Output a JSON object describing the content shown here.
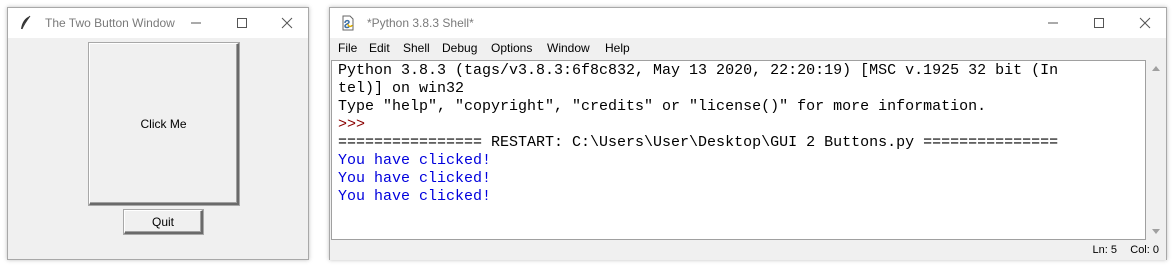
{
  "tk_window": {
    "title": "The Two Button Window",
    "click_button_label": "Click Me",
    "quit_button_label": "Quit"
  },
  "shell_window": {
    "title": "*Python 3.8.3 Shell*",
    "menu": [
      "File",
      "Edit",
      "Shell",
      "Debug",
      "Options",
      "Window",
      "Help"
    ],
    "lines": [
      {
        "text": "Python 3.8.3 (tags/v3.8.3:6f8c832, May 13 2020, 22:20:19) [MSC v.1925 32 bit (In",
        "style": "out"
      },
      {
        "text": "tel)] on win32",
        "style": "out"
      },
      {
        "text": "Type \"help\", \"copyright\", \"credits\" or \"license()\" for more information.",
        "style": "out"
      },
      {
        "text": ">>> ",
        "style": "prompt"
      },
      {
        "text": "================ RESTART: C:\\Users\\User\\Desktop\\GUI 2 Buttons.py ===============",
        "style": "out"
      },
      {
        "text": "You have clicked!",
        "style": "blue"
      },
      {
        "text": "You have clicked!",
        "style": "blue"
      },
      {
        "text": "You have clicked!",
        "style": "blue"
      }
    ],
    "status_ln": "Ln: 5",
    "status_col": "Col: 0"
  },
  "icons": {
    "tk_app": "feather-icon",
    "shell_app": "idle-shell-icon",
    "minimize": "minimize-icon",
    "maximize": "maximize-icon",
    "close": "close-icon"
  },
  "colors": {
    "prompt": "#8b0000",
    "program_output": "#0000dd",
    "title_text": "#7a7a7a"
  }
}
